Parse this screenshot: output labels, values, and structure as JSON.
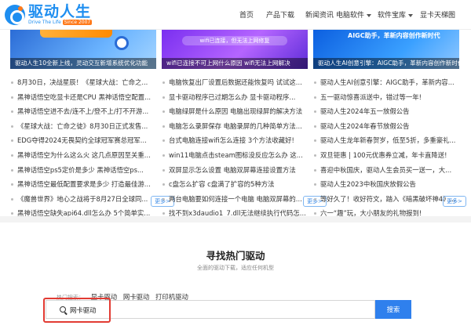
{
  "header": {
    "logo_cn": "驱动人生",
    "logo_en": "Drive The Life",
    "logo_since": "Since 2007",
    "nav": [
      {
        "label": "首页",
        "dropdown": false
      },
      {
        "label": "产品下载",
        "dropdown": false
      },
      {
        "label": "新闻资讯",
        "dropdown": false
      },
      {
        "label": "电脑软件",
        "dropdown": true
      },
      {
        "label": "软件宝库",
        "dropdown": true
      },
      {
        "label": "显卡天梯图",
        "dropdown": false
      }
    ]
  },
  "columns": [
    {
      "banner_caption": "驱动人生10全新上线，灵动交互新增系统优化功能",
      "items": [
        "8月30日，决战星辰！《星球大战：亡命之...",
        "黑神话悟空吃显卡还是CPU 黑神话悟空配置...",
        "黑神话悟空进不去/连不上/登不上/打不开游...",
        "《星球大战：亡命之徒》8月30日正式发售...",
        "EDG夺得2024无畏契约全球冠军赛总冠军...",
        "黑神话悟空为什么这么火 这几点原因至关重...",
        "黑神话悟空ps5定价是多少 黑神话悟空ps...",
        "黑神话悟空最低配置要求是多少 打造最佳游...",
        "《魔兽世界》地心之战将于8月27日全球同...",
        "黑神话悟空缺失api64.dll怎么办 5个简单实..."
      ],
      "more": "更多>"
    },
    {
      "banner_caption": "wifi已连接不可上网什么原因 wifi无法上网解决",
      "banner_pill": "wifi已连接，但无法上网修复",
      "items": [
        "电脑恢复出厂设置后数据还能恢复吗 试试这...",
        "显卡驱动程序已过期怎么办 显卡驱动程序...",
        "电脑绿屏是什么原因 电脑出现绿屏的解决方法",
        "电脑怎么录屏保存 电脑录屏的几种简单方法...",
        "台式电脑连接wifi怎么连接 3个方法收藏好!",
        "win11电脑点击steam图标没反应怎么办 这...",
        "双屏显示怎么设置 电脑双屏幕连接设置方法",
        "c盘怎么扩容 c盘满了扩容的5种方法",
        "两台电脑要如何连接一个电脑 电脑双屏幕的...",
        "找不到x3daudio1_7.dll无法继续执行代码怎..."
      ],
      "more": "更多>"
    },
    {
      "banner_caption": "驱动人生AI创意引擎：AIGC助手，革新内容创作新时代",
      "banner_headline": "AIGC助手，革新内容创作新时代",
      "items": [
        "驱动人生AI创意引擎：AIGC助手，革新内容...",
        "五一驱动惊喜派送中，错过等一年!",
        "驱动人生2024年五一放假公告",
        "驱动人生2024年春节放假公告",
        "驱动人生龙年新春贺岁，低至5折，多重豪礼...",
        "双旦钜惠 | 100元优惠券立减，年卡直降送!",
        "喜迎中秋国庆，驱动人生会员买一送一，大...",
        "驱动人生2023中秋国庆放假公告",
        "等好久了！收好符文，踏入《暗黑破坏神4》...",
        "六一“趣”玩，大小朋友的礼物报到!"
      ],
      "more": "更多>"
    }
  ],
  "search_section": {
    "title": "寻找热门驱动",
    "subtitle": "全面的驱动下载，适应任何机型",
    "hot_label": "热门搜索：",
    "hot_keywords": [
      "显卡驱动",
      "网卡驱动",
      "打印机驱动"
    ],
    "input_value": "网卡驱动",
    "button_label": "搜索"
  }
}
